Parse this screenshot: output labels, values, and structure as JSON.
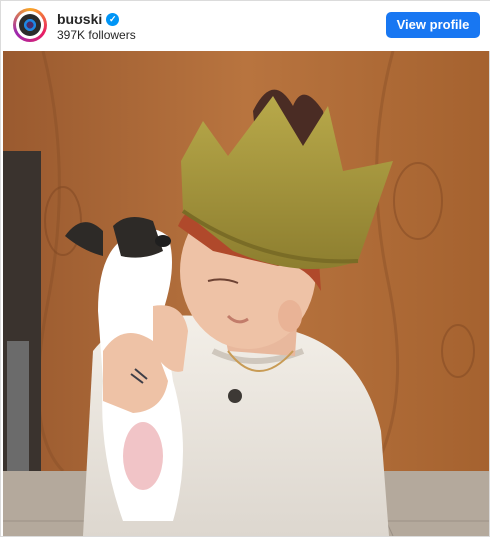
{
  "header": {
    "username": "buʊski",
    "verified_icon": "verified-badge-icon",
    "followers": "397K followers",
    "view_profile_label": "View profile",
    "accent_color": "#1877f2"
  },
  "photo": {
    "image_type": "photo"
  }
}
